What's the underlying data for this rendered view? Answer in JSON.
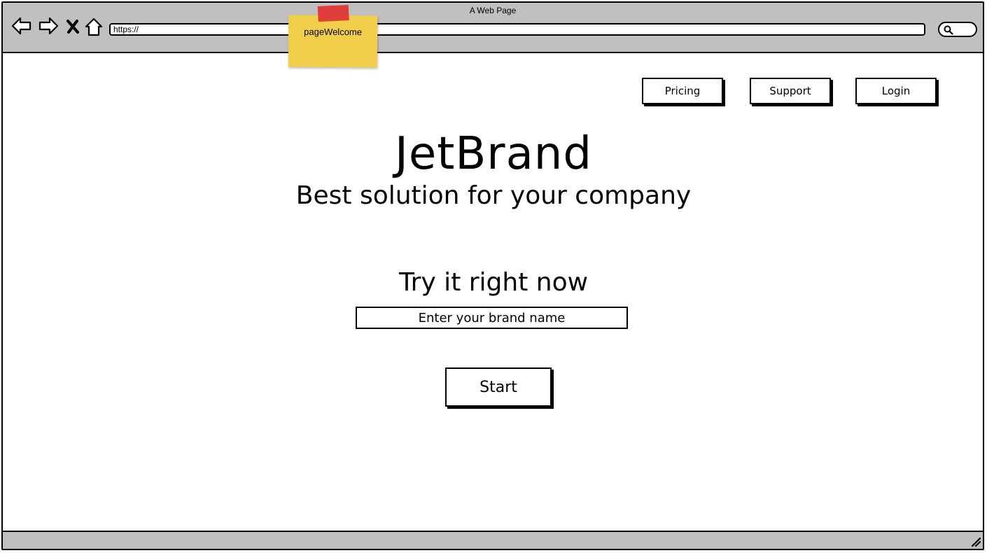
{
  "window": {
    "title": "A Web Page"
  },
  "browser": {
    "url": "https://",
    "icons": [
      "back-arrow-icon",
      "forward-arrow-icon",
      "close-x-icon",
      "home-icon",
      "search-icon",
      "resize-grip-icon"
    ]
  },
  "sticky_note": {
    "label": "pageWelcome",
    "color": "#f2cf4a",
    "tape_color": "#e03535"
  },
  "nav": {
    "pricing_label": "Pricing",
    "support_label": "Support",
    "login_label": "Login"
  },
  "hero": {
    "brand": "JetBrand",
    "tagline": "Best solution for your company"
  },
  "trial": {
    "heading": "Try it right now",
    "input_placeholder": "Enter your brand name",
    "start_label": "Start"
  },
  "colors": {
    "chrome": "#c0c0c0",
    "border": "#000000",
    "background": "#ffffff"
  }
}
